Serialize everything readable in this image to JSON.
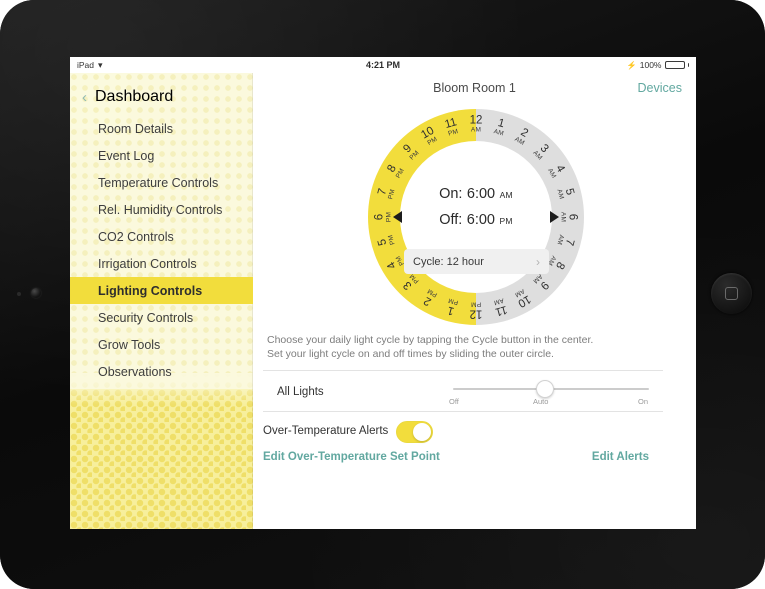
{
  "status_bar": {
    "device_label": "iPad",
    "wifi_icon": "wifi-icon",
    "time": "4:21 PM",
    "battery_percent": "100%",
    "bolt_icon": "lightning-bolt-icon"
  },
  "sidebar": {
    "back_label": "Dashboard",
    "back_icon": "chevron-left-icon",
    "items": [
      {
        "label": "Room Details",
        "active": false
      },
      {
        "label": "Event Log",
        "active": false
      },
      {
        "label": "Temperature Controls",
        "active": false
      },
      {
        "label": "Rel. Humidity Controls",
        "active": false
      },
      {
        "label": "CO2 Controls",
        "active": false
      },
      {
        "label": "Irrigation Controls",
        "active": false
      },
      {
        "label": "Lighting Controls",
        "active": true
      },
      {
        "label": "Security Controls",
        "active": false
      },
      {
        "label": "Grow Tools",
        "active": false
      },
      {
        "label": "Observations",
        "active": false
      }
    ]
  },
  "header": {
    "title": "Bloom Room 1",
    "devices_label": "Devices"
  },
  "dial": {
    "on_label": "On:",
    "on_time": "6:00",
    "on_meridiem": "AM",
    "off_label": "Off:",
    "off_time": "6:00",
    "off_meridiem": "PM",
    "cycle_label": "Cycle: 12 hour",
    "cycle_chevron_icon": "chevron-right-icon",
    "on_marker_icon": "dial-marker-on",
    "off_marker_icon": "dial-marker-off",
    "lit_color": "#f2dd3c",
    "unlit_color": "#dedede",
    "hours": [
      {
        "num": "12",
        "mer": "AM"
      },
      {
        "num": "1",
        "mer": "AM"
      },
      {
        "num": "2",
        "mer": "AM"
      },
      {
        "num": "3",
        "mer": "AM"
      },
      {
        "num": "4",
        "mer": "AM"
      },
      {
        "num": "5",
        "mer": "AM"
      },
      {
        "num": "6",
        "mer": "AM"
      },
      {
        "num": "7",
        "mer": "AM"
      },
      {
        "num": "8",
        "mer": "AM"
      },
      {
        "num": "9",
        "mer": "AM"
      },
      {
        "num": "10",
        "mer": "AM"
      },
      {
        "num": "11",
        "mer": "AM"
      },
      {
        "num": "12",
        "mer": "PM"
      },
      {
        "num": "1",
        "mer": "PM"
      },
      {
        "num": "2",
        "mer": "PM"
      },
      {
        "num": "3",
        "mer": "PM"
      },
      {
        "num": "4",
        "mer": "PM"
      },
      {
        "num": "5",
        "mer": "PM"
      },
      {
        "num": "6",
        "mer": "PM"
      },
      {
        "num": "7",
        "mer": "PM"
      },
      {
        "num": "8",
        "mer": "PM"
      },
      {
        "num": "9",
        "mer": "PM"
      },
      {
        "num": "10",
        "mer": "PM"
      },
      {
        "num": "11",
        "mer": "PM"
      }
    ]
  },
  "instructions": {
    "line1": "Choose your daily light cycle by tapping the Cycle button in the center.",
    "line2": "Set your light cycle on and off times by sliding the outer circle."
  },
  "slider": {
    "label": "All Lights",
    "ticks": [
      "Off",
      "Auto",
      "On"
    ],
    "value": "Auto"
  },
  "toggle": {
    "label": "Over-Temperature Alerts",
    "state": "on",
    "on_color": "#f2dd3c"
  },
  "footer": {
    "edit_setpoint": "Edit Over-Temperature Set Point",
    "edit_alerts": "Edit Alerts",
    "link_color": "#62a8a0"
  }
}
